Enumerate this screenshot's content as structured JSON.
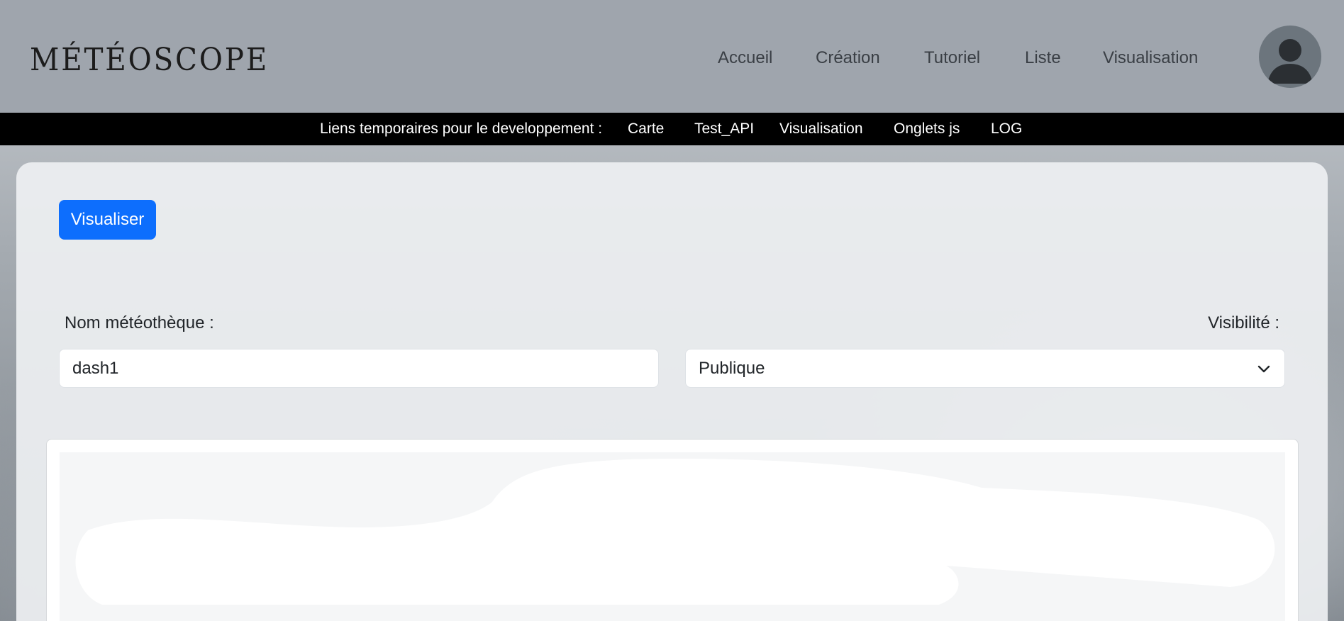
{
  "header": {
    "logo": "MÉTÉOSCOPE",
    "nav": [
      {
        "label": "Accueil"
      },
      {
        "label": "Création"
      },
      {
        "label": "Tutoriel"
      },
      {
        "label": "Liste"
      },
      {
        "label": "Visualisation"
      }
    ],
    "avatar_icon": "user-avatar-icon"
  },
  "devbar": {
    "label": "Liens temporaires pour le developpement :",
    "links": [
      {
        "label": "Carte"
      },
      {
        "label": "Test_API"
      },
      {
        "label": "Visualisation"
      },
      {
        "label": "Onglets js"
      },
      {
        "label": "LOG"
      }
    ]
  },
  "form": {
    "visualize_button": "Visualiser",
    "name_label": "Nom météothèque :",
    "name_value": "dash1",
    "visibility_label": "Visibilité :",
    "visibility_value": "Publique"
  },
  "colors": {
    "primary": "#0d6efd",
    "header_bg": "#9fa5ad",
    "devbar_bg": "#000000"
  }
}
